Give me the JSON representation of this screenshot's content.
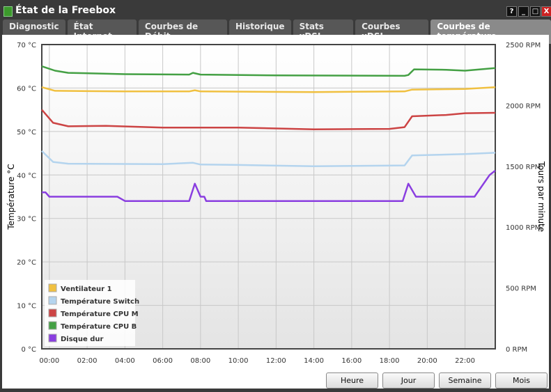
{
  "window": {
    "title": "État de la Freebox",
    "icon": "freebox-icon",
    "buttons": [
      "?",
      "_",
      "□",
      "X"
    ]
  },
  "tabs": [
    {
      "label": "Diagnostic"
    },
    {
      "label": "État Internet"
    },
    {
      "label": "Courbes de Débit"
    },
    {
      "label": "Historique"
    },
    {
      "label": "Stats xDSL"
    },
    {
      "label": "Courbes xDSL"
    },
    {
      "label": "Courbes de température",
      "active": true
    }
  ],
  "range_buttons": [
    "Heure",
    "Jour",
    "Semaine",
    "Mois"
  ],
  "chart_data": {
    "type": "line",
    "ylabel": "Température °C",
    "y2label": "Tours par minute",
    "ylim": [
      0,
      70
    ],
    "y2lim": [
      0,
      2500
    ],
    "xlim_hours": [
      -0.4,
      23.6
    ],
    "yticks": [
      "0 °C",
      "10 °C",
      "20 °C",
      "30 °C",
      "40 °C",
      "50 °C",
      "60 °C",
      "70 °C"
    ],
    "y2ticks": [
      "0 RPM",
      "500 RPM",
      "1000 RPM",
      "1500 RPM",
      "2000 RPM",
      "2500 RPM"
    ],
    "xticks": [
      "00:00",
      "02:00",
      "04:00",
      "06:00",
      "08:00",
      "10:00",
      "12:00",
      "14:00",
      "16:00",
      "18:00",
      "20:00",
      "22:00"
    ],
    "grid": true,
    "legend_position": "bottom-left",
    "series": [
      {
        "name": "Ventilateur 1",
        "color": "#f0c040",
        "axis": "right",
        "points": [
          [
            -0.4,
            2150
          ],
          [
            0.3,
            2120
          ],
          [
            4,
            2115
          ],
          [
            7.4,
            2115
          ],
          [
            7.7,
            2125
          ],
          [
            8,
            2115
          ],
          [
            14,
            2110
          ],
          [
            18.8,
            2115
          ],
          [
            19.2,
            2130
          ],
          [
            22,
            2135
          ],
          [
            23.6,
            2150
          ]
        ]
      },
      {
        "name": "Température Switch",
        "color": "#b4d4ee",
        "axis": "left",
        "points": [
          [
            -0.4,
            45.5
          ],
          [
            0.2,
            43
          ],
          [
            1,
            42.6
          ],
          [
            6,
            42.5
          ],
          [
            7.6,
            42.8
          ],
          [
            8,
            42.4
          ],
          [
            10,
            42.3
          ],
          [
            14,
            42
          ],
          [
            18.8,
            42.2
          ],
          [
            19.2,
            44.5
          ],
          [
            22,
            44.8
          ],
          [
            23.6,
            45.1
          ]
        ]
      },
      {
        "name": "Température CPU M",
        "color": "#cc4444",
        "axis": "left",
        "points": [
          [
            -0.4,
            55
          ],
          [
            0.2,
            52
          ],
          [
            1,
            51.2
          ],
          [
            3,
            51.3
          ],
          [
            6,
            50.9
          ],
          [
            10,
            50.9
          ],
          [
            14,
            50.5
          ],
          [
            18,
            50.6
          ],
          [
            18.8,
            51
          ],
          [
            19.2,
            53.5
          ],
          [
            21,
            53.8
          ],
          [
            22,
            54.2
          ],
          [
            23.6,
            54.3
          ]
        ]
      },
      {
        "name": "Température CPU B",
        "color": "#44a044",
        "axis": "left",
        "points": [
          [
            -0.4,
            65
          ],
          [
            0.3,
            64
          ],
          [
            1,
            63.5
          ],
          [
            4,
            63.2
          ],
          [
            7.4,
            63.1
          ],
          [
            7.6,
            63.5
          ],
          [
            8,
            63.1
          ],
          [
            12,
            62.9
          ],
          [
            18.8,
            62.8
          ],
          [
            19,
            63
          ],
          [
            19.3,
            64.3
          ],
          [
            21,
            64.2
          ],
          [
            22,
            64
          ],
          [
            23.6,
            64.6
          ]
        ]
      },
      {
        "name": "Disque dur",
        "color": "#8a3ee0",
        "axis": "left",
        "points": [
          [
            -0.4,
            36
          ],
          [
            -0.2,
            36
          ],
          [
            0,
            35
          ],
          [
            3.6,
            35
          ],
          [
            3.8,
            34.5
          ],
          [
            4,
            34
          ],
          [
            7.4,
            34
          ],
          [
            7.7,
            38
          ],
          [
            8,
            35
          ],
          [
            8.2,
            35
          ],
          [
            8.3,
            34
          ],
          [
            18.7,
            34
          ],
          [
            19,
            38
          ],
          [
            19.4,
            35
          ],
          [
            22.5,
            35
          ],
          [
            23.3,
            40
          ],
          [
            23.6,
            41
          ]
        ]
      }
    ]
  }
}
